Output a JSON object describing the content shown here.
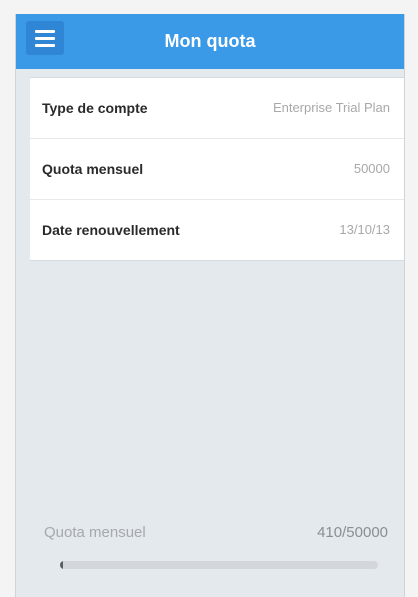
{
  "navbar": {
    "menu_icon": "hamburger-menu-icon",
    "title": "Mon quota"
  },
  "account": {
    "rows": [
      {
        "label": "Type de compte",
        "value": "Enterprise Trial Plan"
      },
      {
        "label": "Quota mensuel",
        "value": "50000"
      },
      {
        "label": "Date renouvellement",
        "value": "13/10/13"
      }
    ]
  },
  "quota": {
    "label": "Quota mensuel",
    "value": "410/50000",
    "used": 410,
    "total": 50000
  },
  "colors": {
    "header": "#3a9ae8",
    "background": "#e4e9ee"
  }
}
